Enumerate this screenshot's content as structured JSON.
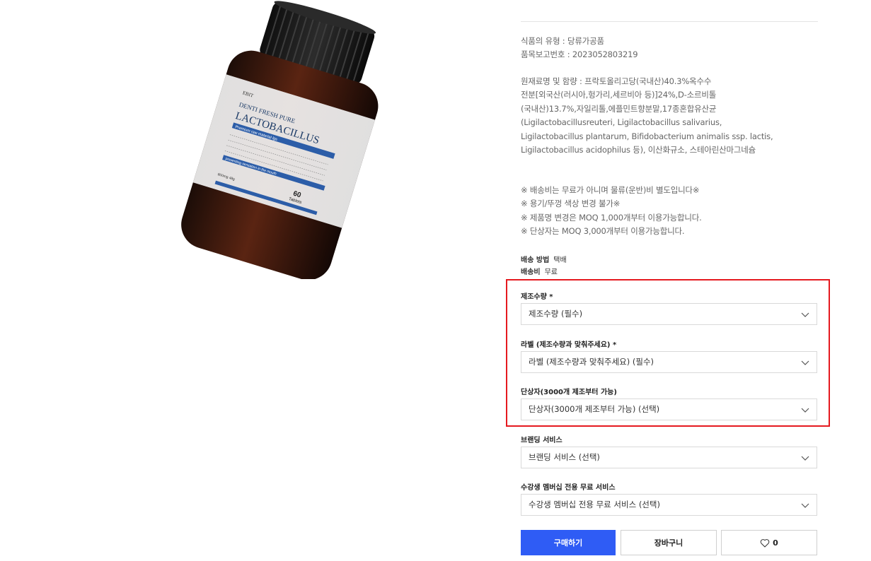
{
  "product": {
    "label_brand": "EBIT",
    "label_line1": "DENTI FRESH PURE",
    "label_line2": "LACTOBACILLUS",
    "label_banner": "Premium raw material lgs",
    "label_footer_banner": "preventing sensation in the mouth",
    "label_count": "60",
    "label_count_unit": "Tablets",
    "label_weight": "800mg 48g"
  },
  "info": {
    "food_type": "식품의 유형 : 당류가공품",
    "report_no": "품목보고번호 : 2023052803219",
    "ingredients": [
      "원재료명 및 함량 : 프락토올리고당(국내산)40.3%옥수수",
      "전분[외국산(러시아,헝가리,세르비아 등)]24%,D-소르비톨",
      "(국내산)13.7%,자일리톨,에플민트향분말,17종혼합유산균",
      "(Ligilactobacillusreuteri, Ligilactobacillus salivarius,",
      "Ligilactobacillus plantarum, Bifidobacterium animalis ssp. lactis,",
      "Ligilactobacillus acidophilus 등), 이산화규소, 스테아린산마그네슘"
    ],
    "notes": [
      "※ 배송비는 무료가 아니며 물류(운반)비 별도입니다※",
      "※ 용기/뚜껑 색상 변경 불가※",
      "※ 제품명 변경은 MOQ 1,000개부터 이용가능합니다.",
      "※ 단상자는 MOQ 3,000개부터 이용가능합니다."
    ],
    "shipping_method_label": "배송 방법",
    "shipping_method_value": "택배",
    "shipping_fee_label": "배송비",
    "shipping_fee_value": "무료"
  },
  "options": [
    {
      "label": "제조수량 *",
      "value": "제조수량 (필수)"
    },
    {
      "label": "라벨 (제조수량과 맞춰주세요) *",
      "value": "라벨 (제조수량과 맞춰주세요) (필수)"
    },
    {
      "label": "단상자(3000개 제조부터 가능)",
      "value": "단상자(3000개 제조부터 가능) (선택)"
    },
    {
      "label": "브랜딩 서비스",
      "value": "브랜딩 서비스 (선택)"
    },
    {
      "label": "수강생 멤버십 전용 무료 서비스",
      "value": "수강생 멤버십 전용 무료 서비스 (선택)"
    }
  ],
  "actions": {
    "buy_label": "구매하기",
    "cart_label": "장바구니",
    "like_count": "0"
  },
  "colors": {
    "buy_button": "#2f5cf5",
    "highlight": "#e5191f"
  },
  "icons": {
    "select_arrow": "chevron-down-icon",
    "like": "heart-icon"
  }
}
